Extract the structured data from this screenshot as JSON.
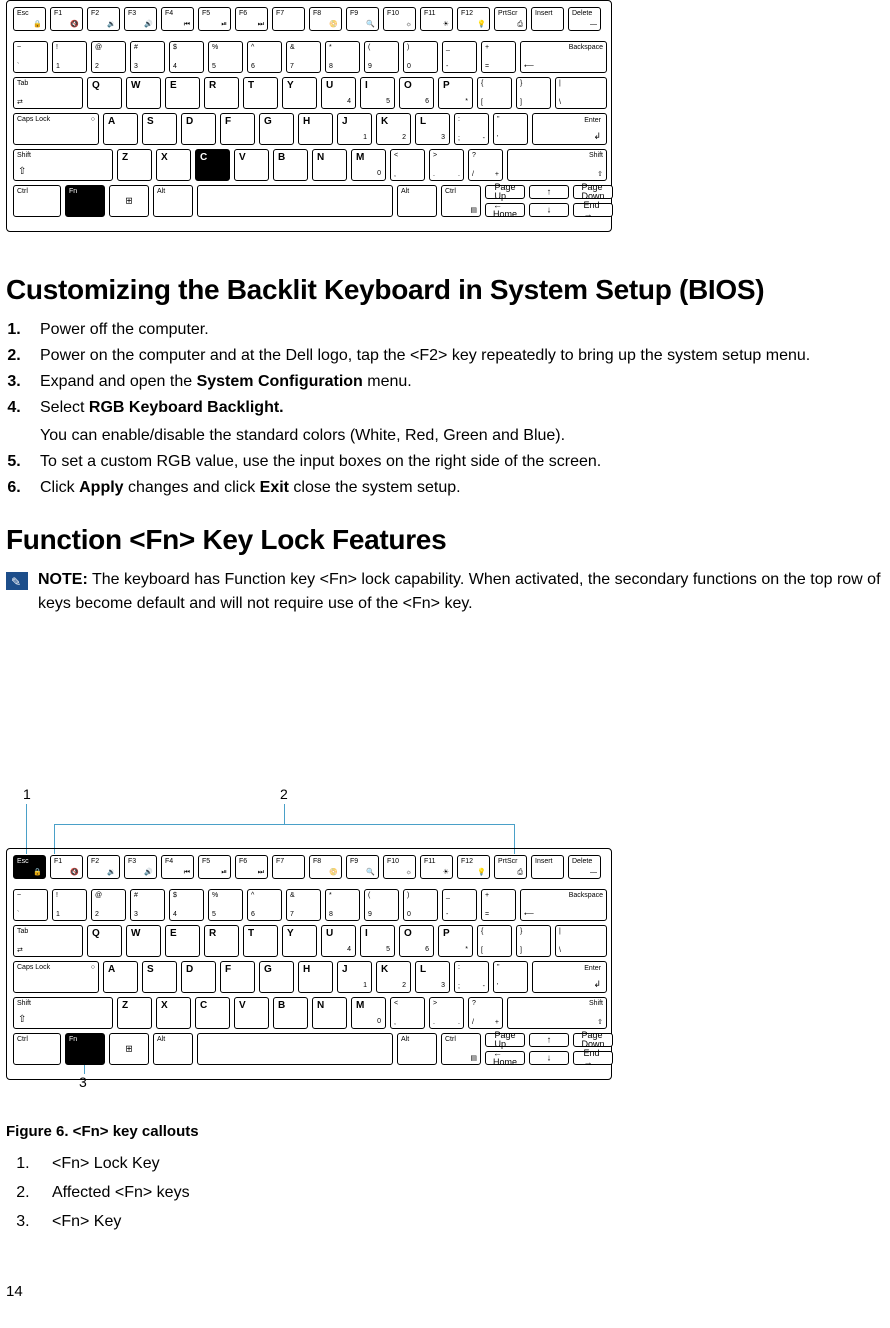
{
  "page_number": "14",
  "heading_bios": "Customizing the Backlit Keyboard in System Setup (BIOS)",
  "steps_bios": {
    "s1": "Power off the computer.",
    "s2": "Power on the computer and at the Dell logo, tap the <F2> key repeatedly to bring up the system setup menu.",
    "s3_a": "Expand and open the ",
    "s3_b": "System Configuration",
    "s3_c": " menu.",
    "s4_a": "Select ",
    "s4_b": "RGB Keyboard Backlight.",
    "s4_sub": "You can enable/disable the standard colors (White, Red, Green and Blue).",
    "s5": "To set a custom RGB value, use the input boxes on the right side of the screen.",
    "s6_a": "Click ",
    "s6_b": "Apply",
    "s6_c": " changes and click ",
    "s6_d": "Exit",
    "s6_e": " close the system setup."
  },
  "heading_fn": "Function <Fn> Key Lock Features",
  "note_label": "NOTE:",
  "note_text": " The keyboard has Function key <Fn> lock capability. When activated, the secondary functions on the top row of keys become default and will not require use of the <Fn> key.",
  "figure_caption": "Figure 6. <Fn> key callouts",
  "callouts": {
    "c1": "<Fn> Lock Key",
    "c2": "Affected <Fn> keys",
    "c3": "<Fn> Key"
  },
  "callout_nums": {
    "n1": "1",
    "n2": "2",
    "n3": "3"
  },
  "keys": {
    "row1": {
      "esc": "Esc",
      "lock": "🔒",
      "f1": "F1",
      "f2": "F2",
      "f3": "F3",
      "f4": "F4",
      "f5": "F5",
      "f6": "F6",
      "f7": "F7",
      "f8": "F8",
      "f9": "F9",
      "f10": "F10",
      "f11": "F11",
      "f12": "F12",
      "i1": "🔇",
      "i2": "🔉",
      "i3": "🔊",
      "i4": "⏮",
      "i5": "⏯",
      "i6": "⏭",
      "i7": "📀",
      "i8": "🔍",
      "i9": "☼",
      "i10": "☀",
      "i11": "💡",
      "prt": "PrtScr",
      "prt2": "⎙",
      "ins": "Insert",
      "del": "Delete",
      "del2": "—"
    },
    "row2": {
      "tilde_t": "~",
      "tilde_b": "`",
      "k1t": "!",
      "k1b": "1",
      "k2t": "@",
      "k2b": "2",
      "k3t": "#",
      "k3b": "3",
      "k4t": "$",
      "k4b": "4",
      "k5t": "%",
      "k5b": "5",
      "k6t": "^",
      "k6b": "6",
      "k7t": "&",
      "k7b": "7",
      "k8t": "*",
      "k8b": "8",
      "k9t": "(",
      "k9b": "9",
      "k0t": ")",
      "k0b": "0",
      "mint": "_",
      "minb": "-",
      "eqt": "+",
      "eqb": "=",
      "bksp": "Backspace",
      "bksp2": "⟵"
    },
    "row3": {
      "tab": "Tab",
      "tab2": "⇄",
      "Q": "Q",
      "W": "W",
      "E": "E",
      "R": "R",
      "T": "T",
      "Y": "Y",
      "U": "U",
      "I": "I",
      "O": "O",
      "P": "P",
      "U4": "4",
      "I5": "5",
      "O6": "6",
      "Pstar": "*",
      "lb_t": "{",
      "lb_b": "[",
      "rb_t": "}",
      "rb_b": "]",
      "bs_t": "|",
      "bs_b": "\\"
    },
    "row4": {
      "caps": "Caps Lock",
      "caps2": "○",
      "A": "A",
      "S": "S",
      "D": "D",
      "F": "F",
      "G": "G",
      "H": "H",
      "J": "J",
      "K": "K",
      "L": "L",
      "J1": "1",
      "K2": "2",
      "L3": "3",
      "semi_t": ":",
      "semi_b": ";",
      "semi_r": "-",
      "apo_t": "\"",
      "apo_b": "'",
      "enter": "Enter",
      "enter2": "↲"
    },
    "row5": {
      "shift": "Shift",
      "shift2": "⇧",
      "Z": "Z",
      "X": "X",
      "C": "C",
      "V": "V",
      "B": "B",
      "N": "N",
      "M": "M",
      "M0": "0",
      "lt_t": "<",
      "lt_b": ",",
      "gt_t": ">",
      "gt_b": ".",
      "gt_r": ".",
      "sl_t": "?",
      "sl_b": "/",
      "sl_r": "+"
    },
    "row6": {
      "ctrl": "Ctrl",
      "fn": "Fn",
      "win": "⊞",
      "alt": "Alt",
      "altR": "Alt",
      "ctrlR": "Ctrl",
      "ctrlR2": "▤",
      "pgup": "Page\nUp",
      "pgdn": "Page\nDown",
      "home": "Home",
      "end": "End",
      "up": "↑",
      "dn": "↓",
      "lt": "←",
      "rt": "→"
    }
  }
}
